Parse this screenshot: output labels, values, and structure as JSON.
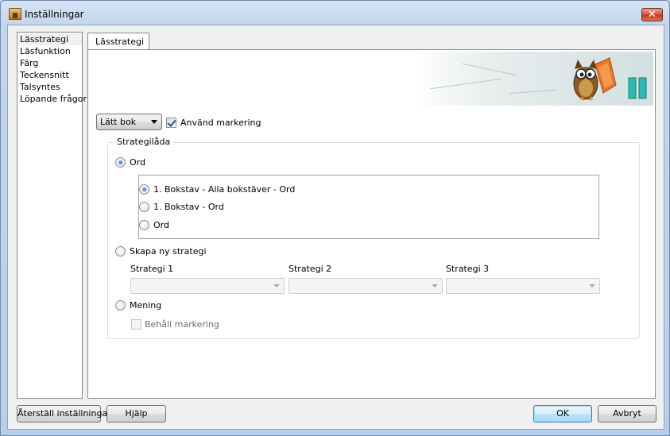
{
  "window": {
    "title": "Inställningar",
    "close_label": "✕"
  },
  "sidebar": {
    "items": [
      {
        "label": "Lässtrategi",
        "selected": true
      },
      {
        "label": "Läsfunktion",
        "selected": false
      },
      {
        "label": "Färg",
        "selected": false
      },
      {
        "label": "Teckensnitt",
        "selected": false
      },
      {
        "label": "Talsyntes",
        "selected": false
      },
      {
        "label": "Löpande frågor",
        "selected": false
      }
    ]
  },
  "tab": {
    "label": "Lässtrategi"
  },
  "level": {
    "selected": "Lätt bok"
  },
  "use_marking": {
    "label": "Använd markering",
    "checked": true
  },
  "strategy_box": {
    "legend": "Strategilåda",
    "ord": {
      "label": "Ord",
      "selected": true
    },
    "ord_options": [
      {
        "label": "1. Bokstav - Alla bokstäver - Ord",
        "selected": true
      },
      {
        "label": "1. Bokstav - Ord",
        "selected": false
      },
      {
        "label": "Ord",
        "selected": false
      }
    ],
    "new_strategy": {
      "label": "Skapa ny strategi",
      "selected": false
    },
    "strategies": [
      {
        "label": "Strategi 1",
        "value": ""
      },
      {
        "label": "Strategi 2",
        "value": ""
      },
      {
        "label": "Strategi 3",
        "value": ""
      }
    ],
    "mening": {
      "label": "Mening",
      "selected": false
    },
    "keep_marking": {
      "label": "Behåll markering",
      "checked": false,
      "enabled": false
    }
  },
  "buttons": {
    "reset": "Återställ inställningar",
    "help": "Hjälp",
    "ok": "OK",
    "cancel": "Avbryt"
  },
  "colors": {
    "accent": "#2b4c9c",
    "window_frame": "#bfd2ea",
    "banner_orange": "#e8762b",
    "banner_teal": "#2fb9b0"
  }
}
